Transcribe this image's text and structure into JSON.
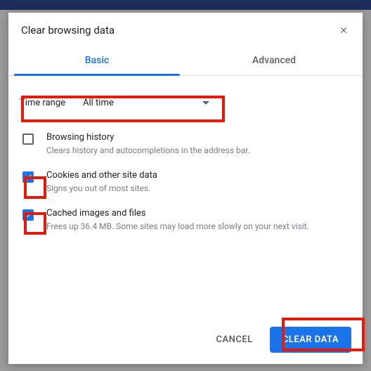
{
  "dialog": {
    "title": "Clear browsing data",
    "tabs": {
      "basic": "Basic",
      "advanced": "Advanced"
    },
    "timerange": {
      "label": "Time range",
      "value": "All time"
    },
    "options": {
      "browsing": {
        "title": "Browsing history",
        "desc": "Clears history and autocompletions in the address bar.",
        "checked": false
      },
      "cookies": {
        "title": "Cookies and other site data",
        "desc": "Signs you out of most sites.",
        "checked": true
      },
      "cache": {
        "title": "Cached images and files",
        "desc": "Frees up 36.4 MB. Some sites may load more slowly on your next visit.",
        "checked": true
      }
    },
    "buttons": {
      "cancel": "CANCEL",
      "clear": "CLEAR DATA"
    }
  }
}
